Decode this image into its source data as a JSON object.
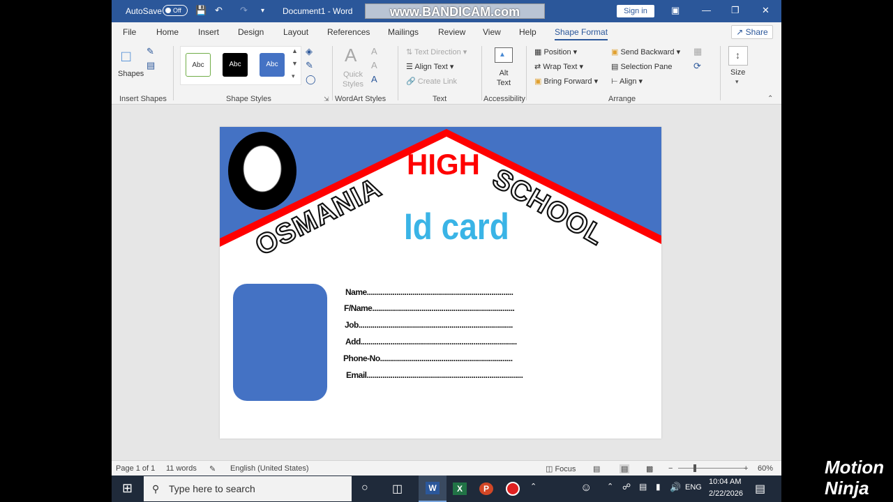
{
  "titlebar": {
    "autosave_label": "AutoSave",
    "autosave_state": "Off",
    "doc_title": "Document1  -  Word",
    "watermark": "www.BANDICAM.com",
    "signin_label": "Sign in"
  },
  "tabs": [
    "File",
    "Home",
    "Insert",
    "Design",
    "Layout",
    "References",
    "Mailings",
    "Review",
    "View",
    "Help",
    "Shape Format"
  ],
  "share_label": "Share",
  "ribbon": {
    "insert_shapes": {
      "shapes_label": "Shapes",
      "group": "Insert Shapes"
    },
    "shape_styles": {
      "style1": "Abc",
      "style2": "Abc",
      "style3": "Abc",
      "group": "Shape Styles"
    },
    "wordart": {
      "quick_styles": "Quick Styles",
      "group": "WordArt Styles"
    },
    "text": {
      "text_direction": "Text Direction",
      "align_text": "Align Text",
      "create_link": "Create Link",
      "group": "Text"
    },
    "accessibility": {
      "alt_text": "Alt Text",
      "group": "Accessibility"
    },
    "arrange": {
      "position": "Position",
      "wrap_text": "Wrap Text",
      "bring_forward": "Bring Forward",
      "send_backward": "Send Backward",
      "selection_pane": "Selection Pane",
      "align": "Align",
      "group": "Arrange"
    },
    "size": {
      "label": "Size"
    }
  },
  "document": {
    "school_word1": "OSMANIA",
    "school_word2": "HIGH",
    "school_word3": "SCHOOL",
    "card_title": "Id card",
    "fields": [
      "Name..........................................................................",
      "F/Name........................................................................",
      "Job..............................................................................",
      "Add...............................................................................",
      "Phone-No...................................................................",
      "Email..............................................................................."
    ],
    "colors": {
      "banner": "#4472c4",
      "stripe": "#ff0000",
      "title_text": "#ff0000",
      "idcard_text": "#3ab4e6",
      "photo": "#4472c4"
    }
  },
  "statusbar": {
    "page": "Page 1 of 1",
    "words": "11 words",
    "language": "English (United States)",
    "focus": "Focus",
    "zoom": "60%"
  },
  "taskbar": {
    "search_placeholder": "Type here to search",
    "lang": "ENG",
    "time": "10:04 AM",
    "date": "2/22/2026"
  },
  "overlay": {
    "line1": "Motion",
    "line2": "Ninja"
  }
}
